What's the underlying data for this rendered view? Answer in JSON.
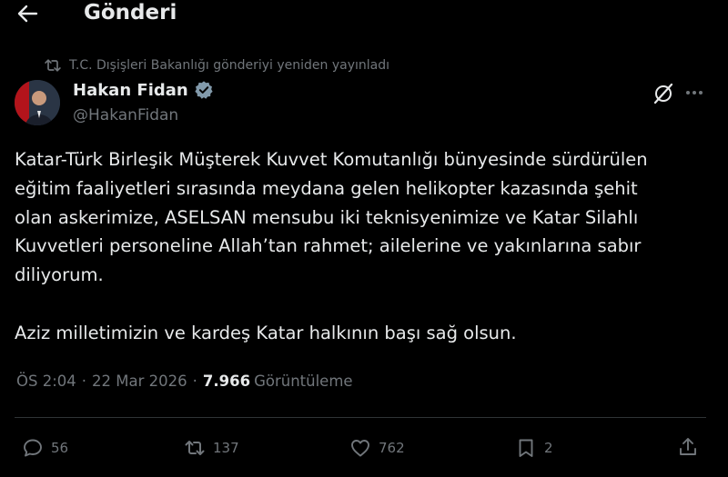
{
  "header": {
    "title": "Gönderi"
  },
  "repost": {
    "text": "T.C. Dışişleri Bakanlığı gönderiyi yeniden yayınladı"
  },
  "author": {
    "name": "Hakan Fidan",
    "handle": "@HakanFidan"
  },
  "post": {
    "text": "Katar-Türk Birleşik Müşterek Kuvvet Komutanlığı bünyesinde sürdürülen\neğitim faaliyetleri sırasında meydana gelen helikopter kazasında şehit\nolan askerimize, ASELSAN mensubu iki teknisyenimize ve Katar Silahlı\nKuvvetleri personeline Allah’tan rahmet; ailelerine ve yakınlarına sabır\ndiliyorum.\n\nAziz milletimizin ve kardeş Katar halkının başı sağ olsun."
  },
  "meta": {
    "time": "ÖS 2:04",
    "separator": "·",
    "date": "22 Mar 2026",
    "views": "7.966",
    "views_label": "Görüntüleme"
  },
  "actions": {
    "replies": "56",
    "reposts": "137",
    "likes": "762",
    "bookmarks": "2"
  },
  "colors": {
    "background": "#000000",
    "text": "#e7e9ea",
    "muted": "#71767b",
    "verified": "#829aab"
  },
  "icons": [
    "back-arrow-icon",
    "repost-icon",
    "verified-icon",
    "grok-icon",
    "more-icon",
    "reply-icon",
    "bookmark-icon",
    "like-icon",
    "share-icon"
  ]
}
